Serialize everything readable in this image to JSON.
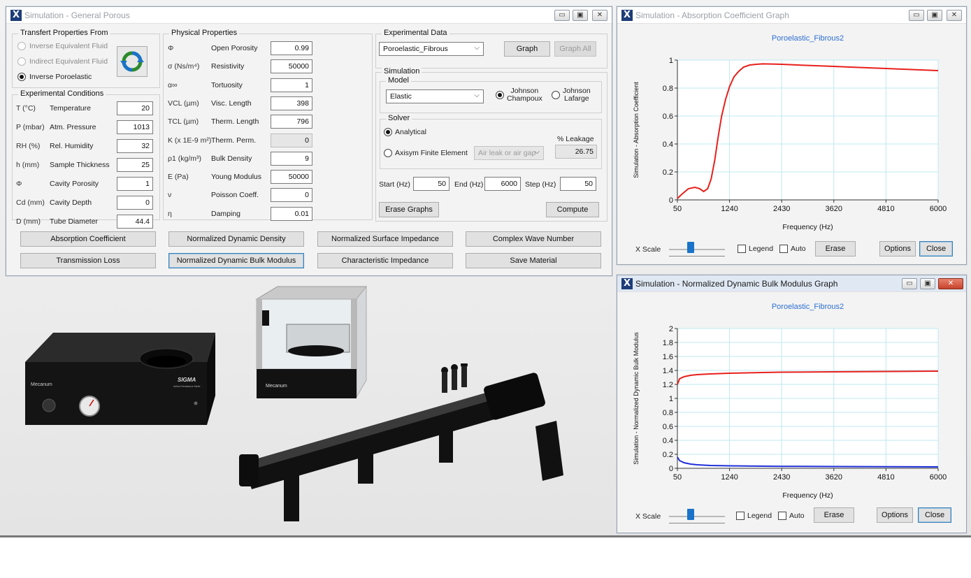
{
  "main_window": {
    "title": "Simulation - General Porous",
    "transfer": {
      "title": "Transfert Properties From",
      "options": [
        "Inverse Equivalent Fluid",
        "Indirect Equivalent Fluid",
        "Inverse Poroelastic"
      ]
    },
    "experimental_conditions": {
      "title": "Experimental Conditions",
      "rows": [
        {
          "sym": "T (°C)",
          "name": "Temperature",
          "value": "20"
        },
        {
          "sym": "P (mbar)",
          "name": "Atm. Pressure",
          "value": "1013"
        },
        {
          "sym": "RH (%)",
          "name": "Rel. Humidity",
          "value": "32"
        },
        {
          "sym": "h (mm)",
          "name": "Sample Thickness",
          "value": "25"
        },
        {
          "sym": "Φ",
          "name": "Cavity Porosity",
          "value": "1"
        },
        {
          "sym": "Cd (mm)",
          "name": "Cavity Depth",
          "value": "0"
        },
        {
          "sym": "D (mm)",
          "name": "Tube Diameter",
          "value": "44.4"
        }
      ]
    },
    "physical_properties": {
      "title": "Physical Properties",
      "rows": [
        {
          "sym": "Φ",
          "name": "Open Porosity",
          "value": "0.99"
        },
        {
          "sym": "σ (Ns/m⁴)",
          "name": "Resistivity",
          "value": "50000"
        },
        {
          "sym": "α∞",
          "name": "Tortuosity",
          "value": "1"
        },
        {
          "sym": "VCL (µm)",
          "name": "Visc. Length",
          "value": "398"
        },
        {
          "sym": "TCL (µm)",
          "name": "Therm. Length",
          "value": "796"
        },
        {
          "sym": "K (x 1E-9 m²)",
          "name": "Therm. Perm.",
          "value": "0"
        },
        {
          "sym": "ρ1 (kg/m³)",
          "name": "Bulk Density",
          "value": "9"
        },
        {
          "sym": "E (Pa)",
          "name": "Young Modulus",
          "value": "50000"
        },
        {
          "sym": "ν",
          "name": "Poisson Coeff.",
          "value": "0"
        },
        {
          "sym": "η",
          "name": "Damping",
          "value": "0.01"
        }
      ]
    },
    "experimental_data": {
      "title": "Experimental Data",
      "selected": "Poroelastic_Fibrous",
      "graph_label": "Graph",
      "graph_all_label": "Graph All"
    },
    "simulation": {
      "title": "Simulation",
      "model_title": "Model",
      "model_selected": "Elastic",
      "johnson_champoux": "Johnson\nChampoux",
      "johnson_lafarge": "Johnson\nLafarge",
      "solver_title": "Solver",
      "analytical": "Analytical",
      "axisym": "Axisym Finite Element",
      "air_leak": "Air leak or air gap",
      "leakage_label": "% Leakage",
      "leakage_value": "26.75",
      "start_label": "Start (Hz)",
      "start_value": "50",
      "end_label": "End (Hz)",
      "end_value": "6000",
      "step_label": "Step (Hz)",
      "step_value": "50",
      "erase_graphs": "Erase Graphs",
      "compute": "Compute"
    },
    "buttons": [
      "Absorption Coefficient",
      "Normalized Dynamic Density",
      "Normalized Surface Impedance",
      "Complex Wave Number",
      "Transmission Loss",
      "Normalized Dynamic Bulk Modulus",
      "Characteristic Impedance",
      "Save Material"
    ]
  },
  "graph_windows": [
    {
      "title": "Simulation - Absorption Coefficient Graph",
      "x_scale_label": "X Scale",
      "legend_label": "Legend",
      "auto_label": "Auto",
      "erase_label": "Erase",
      "options_label": "Options",
      "close_label": "Close",
      "chart_data": {
        "type": "line",
        "title": "Poroelastic_Fibrous2",
        "xlabel": "Frequency (Hz)",
        "ylabel": "Simulation - Absorption Coefficient",
        "xlim": [
          50,
          6000
        ],
        "ylim": [
          0,
          1
        ],
        "xticks": [
          50,
          1240,
          2430,
          3620,
          4810,
          6000
        ],
        "yticks": [
          0,
          0.2,
          0.4,
          0.6,
          0.8,
          1
        ],
        "ytick_labels": [
          "0",
          "0.2",
          "0.4",
          "0.6",
          "0.8",
          "1"
        ],
        "grid": true,
        "series": [
          {
            "color": "#e8201c",
            "x": [
              50,
              150,
              300,
              450,
              560,
              650,
              740,
              820,
              900,
              980,
              1060,
              1150,
              1240,
              1340,
              1450,
              1560,
              1700,
              1850,
              2000,
              2200,
              2430,
              2800,
              3200,
              3620,
              4000,
              4400,
              4810,
              5200,
              5600,
              6000
            ],
            "y": [
              0.01,
              0.04,
              0.08,
              0.09,
              0.08,
              0.06,
              0.08,
              0.15,
              0.28,
              0.45,
              0.6,
              0.72,
              0.81,
              0.88,
              0.92,
              0.95,
              0.965,
              0.97,
              0.973,
              0.972,
              0.97,
              0.965,
              0.96,
              0.955,
              0.95,
              0.945,
              0.94,
              0.935,
              0.93,
              0.925
            ]
          }
        ]
      }
    },
    {
      "title": "Simulation - Normalized Dynamic Bulk Modulus  Graph",
      "x_scale_label": "X Scale",
      "legend_label": "Legend",
      "auto_label": "Auto",
      "erase_label": "Erase",
      "options_label": "Options",
      "close_label": "Close",
      "chart_data": {
        "type": "line",
        "title": "Poroelastic_Fibrous2",
        "xlabel": "Frequency (Hz)",
        "ylabel": "Simulation - Normalized Dynamic Bulk Modulus",
        "xlim": [
          50,
          6000
        ],
        "ylim": [
          0,
          2
        ],
        "xticks": [
          50,
          1240,
          2430,
          3620,
          4810,
          6000
        ],
        "yticks": [
          0,
          0.2,
          0.4,
          0.6,
          0.8,
          1,
          1.2,
          1.4,
          1.6,
          1.8,
          2
        ],
        "ytick_labels": [
          "0",
          "0.2",
          "0.4",
          "0.6",
          "0.8",
          "1",
          "1.2",
          "1.4",
          "1.6",
          "1.8",
          "2"
        ],
        "grid": true,
        "series": [
          {
            "color": "#e8201c",
            "x": [
              50,
              100,
              200,
              350,
              500,
              800,
              1240,
              2000,
              2430,
              3620,
              4810,
              6000
            ],
            "y": [
              1.2,
              1.28,
              1.31,
              1.33,
              1.34,
              1.35,
              1.36,
              1.37,
              1.375,
              1.38,
              1.385,
              1.39
            ]
          },
          {
            "color": "#1f2fd8",
            "x": [
              50,
              100,
              200,
              350,
              500,
              800,
              1240,
              2000,
              2430,
              3620,
              4810,
              6000
            ],
            "y": [
              0.16,
              0.11,
              0.08,
              0.06,
              0.05,
              0.04,
              0.035,
              0.03,
              0.028,
              0.025,
              0.022,
              0.02
            ]
          }
        ]
      }
    }
  ],
  "product_labels": {
    "brand": "Mecanum",
    "sigma": "SIGMA",
    "sigma_sub": "Airflow Resistance Meter"
  }
}
